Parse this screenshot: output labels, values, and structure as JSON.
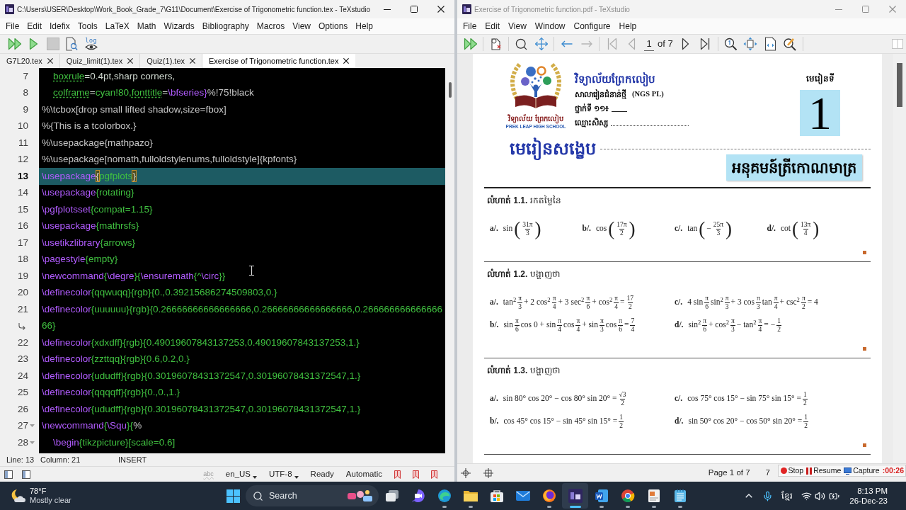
{
  "left_window": {
    "active": true,
    "title": "C:\\Users\\USER\\Desktop\\Work_Book_Grade_7\\G11\\Document\\Exercise of Trigonometric function.tex - TeXstudio",
    "menu": [
      "File",
      "Edit",
      "Idefix",
      "Tools",
      "LaTeX",
      "Math",
      "Wizards",
      "Bibliography",
      "Macros",
      "View",
      "Options",
      "Help"
    ],
    "toolbar": [
      {
        "kind": "build-view",
        "disabled": false
      },
      {
        "kind": "compile",
        "disabled": false
      },
      {
        "kind": "stop",
        "disabled": true
      },
      {
        "kind": "view",
        "disabled": false
      },
      {
        "kind": "log",
        "label": "log",
        "disabled": false
      }
    ],
    "tabs": [
      {
        "label": "G7L20.tex",
        "selected": false
      },
      {
        "label": "Quiz_limit(1).tex",
        "selected": false
      },
      {
        "label": "Quiz(1).tex",
        "selected": false
      },
      {
        "label": "Exercise of Trigonometric function.tex",
        "selected": true
      }
    ],
    "editor": {
      "lines": [
        {
          "kind": "line",
          "number": "7",
          "current": false,
          "fold": false,
          "indented": true,
          "segments": [
            {
              "kind": "misspelled",
              "text": "boxrule"
            },
            {
              "kind": "plain",
              "text": "=0.4pt,sharp corners,"
            }
          ]
        },
        {
          "kind": "line",
          "number": "8",
          "current": false,
          "fold": false,
          "indented": true,
          "segments": [
            {
              "kind": "misspelled",
              "text": "colframe"
            },
            {
              "kind": "plain",
              "text": "="
            },
            {
              "kind": "argument",
              "text": "cyan!80,"
            },
            {
              "kind": "misspelled",
              "text": "fonttitle"
            },
            {
              "kind": "plain",
              "text": "="
            },
            {
              "kind": "command",
              "text": "\\bfseries}"
            },
            {
              "kind": "comment",
              "text": "%!75!black"
            }
          ]
        },
        {
          "kind": "line",
          "number": "9",
          "current": false,
          "fold": false,
          "indented": false,
          "segments": [
            {
              "kind": "comment",
              "text": "%\\tcbox[drop small lifted shadow,size=fbox]"
            }
          ]
        },
        {
          "kind": "line",
          "number": "10",
          "current": false,
          "fold": false,
          "indented": false,
          "segments": [
            {
              "kind": "comment",
              "text": "%{This is a tcolorbox.}"
            }
          ]
        },
        {
          "kind": "line",
          "number": "11",
          "current": false,
          "fold": false,
          "indented": false,
          "segments": [
            {
              "kind": "comment",
              "text": "%\\usepackage{mathpazo}"
            }
          ]
        },
        {
          "kind": "line",
          "number": "12",
          "current": false,
          "fold": false,
          "indented": false,
          "segments": [
            {
              "kind": "comment",
              "text": "%\\usepackage[nomath,fulloldstylenums,fulloldstyle]{kpfonts}"
            }
          ]
        },
        {
          "kind": "line",
          "number": "13",
          "current": true,
          "fold": false,
          "indented": false,
          "segments": [
            {
              "kind": "command",
              "text": "\\usepackage"
            },
            {
              "kind": "bracket-match",
              "text": "{"
            },
            {
              "kind": "argument",
              "text": "pgfplots"
            },
            {
              "kind": "bracket-match",
              "text": "}"
            }
          ]
        },
        {
          "kind": "line",
          "number": "14",
          "current": false,
          "fold": false,
          "indented": false,
          "segments": [
            {
              "kind": "command",
              "text": "\\usepackage"
            },
            {
              "kind": "argument",
              "text": "{rotating}"
            }
          ]
        },
        {
          "kind": "line",
          "number": "15",
          "current": false,
          "fold": false,
          "indented": false,
          "segments": [
            {
              "kind": "command",
              "text": "\\pgfplotsset"
            },
            {
              "kind": "argument",
              "text": "{compat=1.15}"
            }
          ]
        },
        {
          "kind": "line",
          "number": "16",
          "current": false,
          "fold": false,
          "indented": false,
          "segments": [
            {
              "kind": "command",
              "text": "\\usepackage"
            },
            {
              "kind": "argument",
              "text": "{mathrsfs}"
            }
          ]
        },
        {
          "kind": "line",
          "number": "17",
          "current": false,
          "fold": false,
          "indented": false,
          "segments": [
            {
              "kind": "command",
              "text": "\\usetikzlibrary"
            },
            {
              "kind": "argument",
              "text": "{arrows}"
            }
          ]
        },
        {
          "kind": "line",
          "number": "18",
          "current": false,
          "fold": false,
          "indented": false,
          "segments": [
            {
              "kind": "command",
              "text": "\\pagestyle"
            },
            {
              "kind": "argument",
              "text": "{empty}"
            }
          ]
        },
        {
          "kind": "line",
          "number": "19",
          "current": false,
          "fold": false,
          "indented": false,
          "segments": [
            {
              "kind": "command",
              "text": "\\newcommand"
            },
            {
              "kind": "argument",
              "text": "{"
            },
            {
              "kind": "command",
              "text": "\\degre"
            },
            {
              "kind": "argument",
              "text": "}{"
            },
            {
              "kind": "command",
              "text": "\\ensuremath"
            },
            {
              "kind": "argument",
              "text": "{^"
            },
            {
              "kind": "command",
              "text": "\\circ"
            },
            {
              "kind": "argument",
              "text": "}}"
            }
          ]
        },
        {
          "kind": "line",
          "number": "20",
          "current": false,
          "fold": false,
          "indented": false,
          "segments": [
            {
              "kind": "command",
              "text": "\\definecolor"
            },
            {
              "kind": "argument",
              "text": "{qqwuqq}{rgb}{0.,0.39215686274509803,0.}"
            }
          ]
        },
        {
          "kind": "line",
          "number": "21",
          "current": false,
          "fold": false,
          "indented": false,
          "segments": [
            {
              "kind": "command",
              "text": "\\definecolor"
            },
            {
              "kind": "argument",
              "text": "{uuuuuu}{rgb}{0.26666666666666666,0.26666666666666666,0.266666666666666"
            }
          ]
        },
        {
          "kind": "wrap",
          "current": false,
          "fold": false,
          "indented": false,
          "segments": [
            {
              "kind": "argument",
              "text": "66}"
            }
          ]
        },
        {
          "kind": "line",
          "number": "22",
          "current": false,
          "fold": false,
          "indented": false,
          "segments": [
            {
              "kind": "command",
              "text": "\\definecolor"
            },
            {
              "kind": "argument",
              "text": "{xdxdff}{rgb}{0.49019607843137253,0.49019607843137253,1.}"
            }
          ]
        },
        {
          "kind": "line",
          "number": "23",
          "current": false,
          "fold": false,
          "indented": false,
          "segments": [
            {
              "kind": "command",
              "text": "\\definecolor"
            },
            {
              "kind": "argument",
              "text": "{zzttqq}{rgb}{0.6,0.2,0.}"
            }
          ]
        },
        {
          "kind": "line",
          "number": "24",
          "current": false,
          "fold": false,
          "indented": false,
          "segments": [
            {
              "kind": "command",
              "text": "\\definecolor"
            },
            {
              "kind": "argument",
              "text": "{ududff}{rgb}{0.30196078431372547,0.30196078431372547,1.}"
            }
          ]
        },
        {
          "kind": "line",
          "number": "25",
          "current": false,
          "fold": false,
          "indented": false,
          "segments": [
            {
              "kind": "command",
              "text": "\\definecolor"
            },
            {
              "kind": "argument",
              "text": "{qqqqff}{rgb}{0.,0.,1.}"
            }
          ]
        },
        {
          "kind": "line",
          "number": "26",
          "current": false,
          "fold": false,
          "indented": false,
          "segments": [
            {
              "kind": "command",
              "text": "\\definecolor"
            },
            {
              "kind": "argument",
              "text": "{ududff}{rgb}{0.30196078431372547,0.30196078431372547,1.}"
            }
          ]
        },
        {
          "kind": "line",
          "number": "27",
          "current": false,
          "fold": true,
          "indented": false,
          "segments": [
            {
              "kind": "command",
              "text": "\\newcommand"
            },
            {
              "kind": "argument",
              "text": "{"
            },
            {
              "kind": "command",
              "text": "\\Squ"
            },
            {
              "kind": "argument",
              "text": "}{"
            },
            {
              "kind": "comment",
              "text": "%"
            }
          ]
        },
        {
          "kind": "line",
          "number": "28",
          "current": false,
          "fold": true,
          "indented": true,
          "segments": [
            {
              "kind": "command",
              "text": "\\begin"
            },
            {
              "kind": "argument",
              "text": "{tikzpicture}[scale=0.6]"
            }
          ]
        }
      ]
    },
    "status": {
      "line": "Line: 13",
      "column": "Column: 21",
      "mode": "INSERT"
    },
    "status_bar": [
      {
        "kind": "spell",
        "label": "abc"
      },
      {
        "kind": "dropdown",
        "label": "en_US"
      },
      {
        "kind": "dropdown",
        "label": "UTF-8"
      },
      {
        "kind": "text",
        "label": "Ready"
      },
      {
        "kind": "text",
        "label": "Automatic"
      },
      {
        "kind": "bookmark"
      },
      {
        "kind": "bookmark"
      },
      {
        "kind": "bookmark"
      }
    ]
  },
  "right_window": {
    "active": false,
    "title": "Exercise of Trigonometric function.pdf - TeXstudio",
    "menu": [
      "File",
      "Edit",
      "View",
      "Window",
      "Configure",
      "Help"
    ],
    "toolbar": [
      {
        "kind": "build-view",
        "disabled": false
      },
      {
        "kind": "sync",
        "disabled": false
      },
      {
        "kind": "search",
        "disabled": false
      },
      {
        "kind": "pan",
        "disabled": false
      },
      {
        "kind": "back",
        "disabled": false
      },
      {
        "kind": "forward",
        "disabled": true
      },
      {
        "kind": "first",
        "disabled": true
      },
      {
        "kind": "prev",
        "disabled": true
      },
      {
        "kind": "page",
        "value": "1",
        "label": "of 7"
      },
      {
        "kind": "next",
        "disabled": false
      },
      {
        "kind": "last",
        "disabled": false
      },
      {
        "kind": "zoom",
        "disabled": false
      },
      {
        "kind": "fit-width",
        "disabled": false
      },
      {
        "kind": "fit-page",
        "disabled": false
      },
      {
        "kind": "magnifier",
        "disabled": false
      }
    ],
    "document": {
      "logo_caption": "វិទ្យាល័យ ព្រែកលៀប",
      "logo_caption_en": "PREK LEAP HIGH SCHOOL",
      "school": "វិទ្យាល័យព្រែកលៀប",
      "program": "សាលារៀនជំនាន់ថ្មី",
      "program_code": "(NGS PL)",
      "class_label": "ថ្នាក់ទី ១១៖",
      "name_label": "ឈ្មោះសិស្ស",
      "lesson_label": "មេរៀនទី",
      "lesson_number": "1",
      "summary_heading": "មេរៀនសង្ខេប",
      "chapter_title": "អនុគមន៍ត្រីកោណមាត្រ",
      "exercises": [
        {
          "kind": "inline",
          "heading": "**លំហាត់ 1.1.** រកតម្លៃនៃ",
          "items": [
            {
              "label": "a/.",
              "parts": [
                {
                  "kind": "text",
                  "text": "sin"
                },
                {
                  "kind": "paren",
                  "text": "("
                },
                {
                  "kind": "frac",
                  "num": "31π",
                  "den": "3"
                },
                {
                  "kind": "paren",
                  "text": ")"
                }
              ]
            },
            {
              "label": "b/.",
              "parts": [
                {
                  "kind": "text",
                  "text": "cos"
                },
                {
                  "kind": "paren",
                  "text": "("
                },
                {
                  "kind": "frac",
                  "num": "17π",
                  "den": "2"
                },
                {
                  "kind": "paren",
                  "text": ")"
                }
              ]
            },
            {
              "label": "c/.",
              "parts": [
                {
                  "kind": "text",
                  "text": "tan"
                },
                {
                  "kind": "paren",
                  "text": "("
                },
                {
                  "kind": "text",
                  "text": "−"
                },
                {
                  "kind": "frac",
                  "num": "25π",
                  "den": "3"
                },
                {
                  "kind": "paren",
                  "text": ")"
                }
              ]
            },
            {
              "label": "d/.",
              "parts": [
                {
                  "kind": "text",
                  "text": "cot"
                },
                {
                  "kind": "paren",
                  "text": "("
                },
                {
                  "kind": "frac",
                  "num": "13π",
                  "den": "4"
                },
                {
                  "kind": "paren",
                  "text": ")"
                }
              ]
            }
          ]
        },
        {
          "kind": "two-column",
          "heading": "**លំហាត់ 1.2.** បង្ហាញថា",
          "items": [
            {
              "label": "a/.",
              "parts": [
                {
                  "kind": "text",
                  "text": "tan$^{2}$"
                },
                {
                  "kind": "frac",
                  "num": "π",
                  "den": "3"
                },
                {
                  "kind": "text",
                  "text": "+ 2 cos$^{2}$"
                },
                {
                  "kind": "frac",
                  "num": "π",
                  "den": "4"
                },
                {
                  "kind": "text",
                  "text": "+ 3 sec$^{2}$"
                },
                {
                  "kind": "frac",
                  "num": "π",
                  "den": "6"
                },
                {
                  "kind": "text",
                  "text": "+ cos$^{2}$"
                },
                {
                  "kind": "frac",
                  "num": "π",
                  "den": "4"
                },
                {
                  "kind": "text",
                  "text": "="
                },
                {
                  "kind": "frac",
                  "num": "17",
                  "den": "2"
                }
              ]
            },
            {
              "label": "c/.",
              "parts": [
                {
                  "kind": "text",
                  "text": "4 sin"
                },
                {
                  "kind": "frac",
                  "num": "π",
                  "den": "6"
                },
                {
                  "kind": "text",
                  "text": "sin$^{2}$"
                },
                {
                  "kind": "frac",
                  "num": "π",
                  "den": "3"
                },
                {
                  "kind": "text",
                  "text": "+ 3 cos"
                },
                {
                  "kind": "frac",
                  "num": "π",
                  "den": "3"
                },
                {
                  "kind": "text",
                  "text": "tan"
                },
                {
                  "kind": "frac",
                  "num": "π",
                  "den": "4"
                },
                {
                  "kind": "text",
                  "text": "+ csc$^{2}$"
                },
                {
                  "kind": "frac",
                  "num": "π",
                  "den": "2"
                },
                {
                  "kind": "text",
                  "text": "= 4"
                }
              ]
            },
            {
              "label": "b/.",
              "parts": [
                {
                  "kind": "text",
                  "text": "sin"
                },
                {
                  "kind": "frac",
                  "num": "π",
                  "den": "6"
                },
                {
                  "kind": "text",
                  "text": "cos 0 + sin"
                },
                {
                  "kind": "frac",
                  "num": "π",
                  "den": "4"
                },
                {
                  "kind": "text",
                  "text": "cos"
                },
                {
                  "kind": "frac",
                  "num": "π",
                  "den": "4"
                },
                {
                  "kind": "text",
                  "text": "+ sin"
                },
                {
                  "kind": "frac",
                  "num": "π",
                  "den": "3"
                },
                {
                  "kind": "text",
                  "text": "cos"
                },
                {
                  "kind": "frac",
                  "num": "π",
                  "den": "6"
                },
                {
                  "kind": "text",
                  "text": "="
                },
                {
                  "kind": "frac",
                  "num": "7",
                  "den": "4"
                }
              ]
            },
            {
              "label": "d/.",
              "parts": [
                {
                  "kind": "text",
                  "text": "sin$^{2}$"
                },
                {
                  "kind": "frac",
                  "num": "π",
                  "den": "6"
                },
                {
                  "kind": "text",
                  "text": "+ cos$^{2}$"
                },
                {
                  "kind": "frac",
                  "num": "π",
                  "den": "3"
                },
                {
                  "kind": "text",
                  "text": "− tan$^{2}$"
                },
                {
                  "kind": "frac",
                  "num": "π",
                  "den": "4"
                },
                {
                  "kind": "text",
                  "text": "= −"
                },
                {
                  "kind": "frac",
                  "num": "1",
                  "den": "2"
                }
              ]
            }
          ]
        },
        {
          "kind": "two-column",
          "heading": "**លំហាត់ 1.3.** បង្ហាញថា",
          "items": [
            {
              "label": "a/.",
              "parts": [
                {
                  "kind": "text",
                  "text": "sin 80° cos 20° − cos 80° sin 20° ="
                },
                {
                  "kind": "frac",
                  "num": "√3",
                  "den": "2"
                }
              ]
            },
            {
              "label": "c/.",
              "parts": [
                {
                  "kind": "text",
                  "text": "cos 75° cos 15° − sin 75° sin 15° ="
                },
                {
                  "kind": "frac",
                  "num": "1",
                  "den": "2"
                }
              ]
            },
            {
              "label": "b/.",
              "parts": [
                {
                  "kind": "text",
                  "text": "cos 45° cos 15° − sin 45° sin 15° ="
                },
                {
                  "kind": "frac",
                  "num": "1",
                  "den": "2"
                }
              ]
            },
            {
              "label": "d/.",
              "parts": [
                {
                  "kind": "text",
                  "text": "sin 50° cos 20° − cos 50° sin 20° ="
                },
                {
                  "kind": "frac",
                  "num": "1",
                  "den": "2"
                }
              ]
            }
          ]
        }
      ]
    },
    "status": {
      "page": "Page 1 of 7",
      "zoom": "7"
    },
    "recorder": {
      "buttons": [
        {
          "kind": "stop",
          "label": "Stop"
        },
        {
          "kind": "resume",
          "label": "Resume"
        },
        {
          "kind": "capture",
          "label": "Capture"
        }
      ],
      "timer": ":00:26"
    }
  },
  "taskbar": {
    "weather": {
      "temperature": "78°F",
      "condition": "Mostly clear"
    },
    "search": {
      "placeholder": "Search"
    },
    "apps": [
      {
        "kind": "task-view",
        "running": false,
        "selected": false
      },
      {
        "kind": "chat",
        "running": false,
        "selected": false
      },
      {
        "kind": "edge",
        "running": true,
        "selected": false
      },
      {
        "kind": "explorer",
        "running": true,
        "selected": false
      },
      {
        "kind": "store",
        "running": false,
        "selected": false
      },
      {
        "kind": "mail",
        "running": false,
        "selected": false
      },
      {
        "kind": "firefox",
        "running": true,
        "selected": false
      },
      {
        "kind": "texstudio",
        "running": true,
        "selected": true
      },
      {
        "kind": "word",
        "running": true,
        "selected": false
      },
      {
        "kind": "chrome",
        "running": true,
        "selected": false
      },
      {
        "kind": "viewer",
        "running": true,
        "selected": false
      },
      {
        "kind": "notepad",
        "running": true,
        "selected": false
      }
    ],
    "tray": {
      "language": "ខ្មែរ",
      "time": "8:13 PM",
      "date": "26-Dec-23"
    }
  }
}
